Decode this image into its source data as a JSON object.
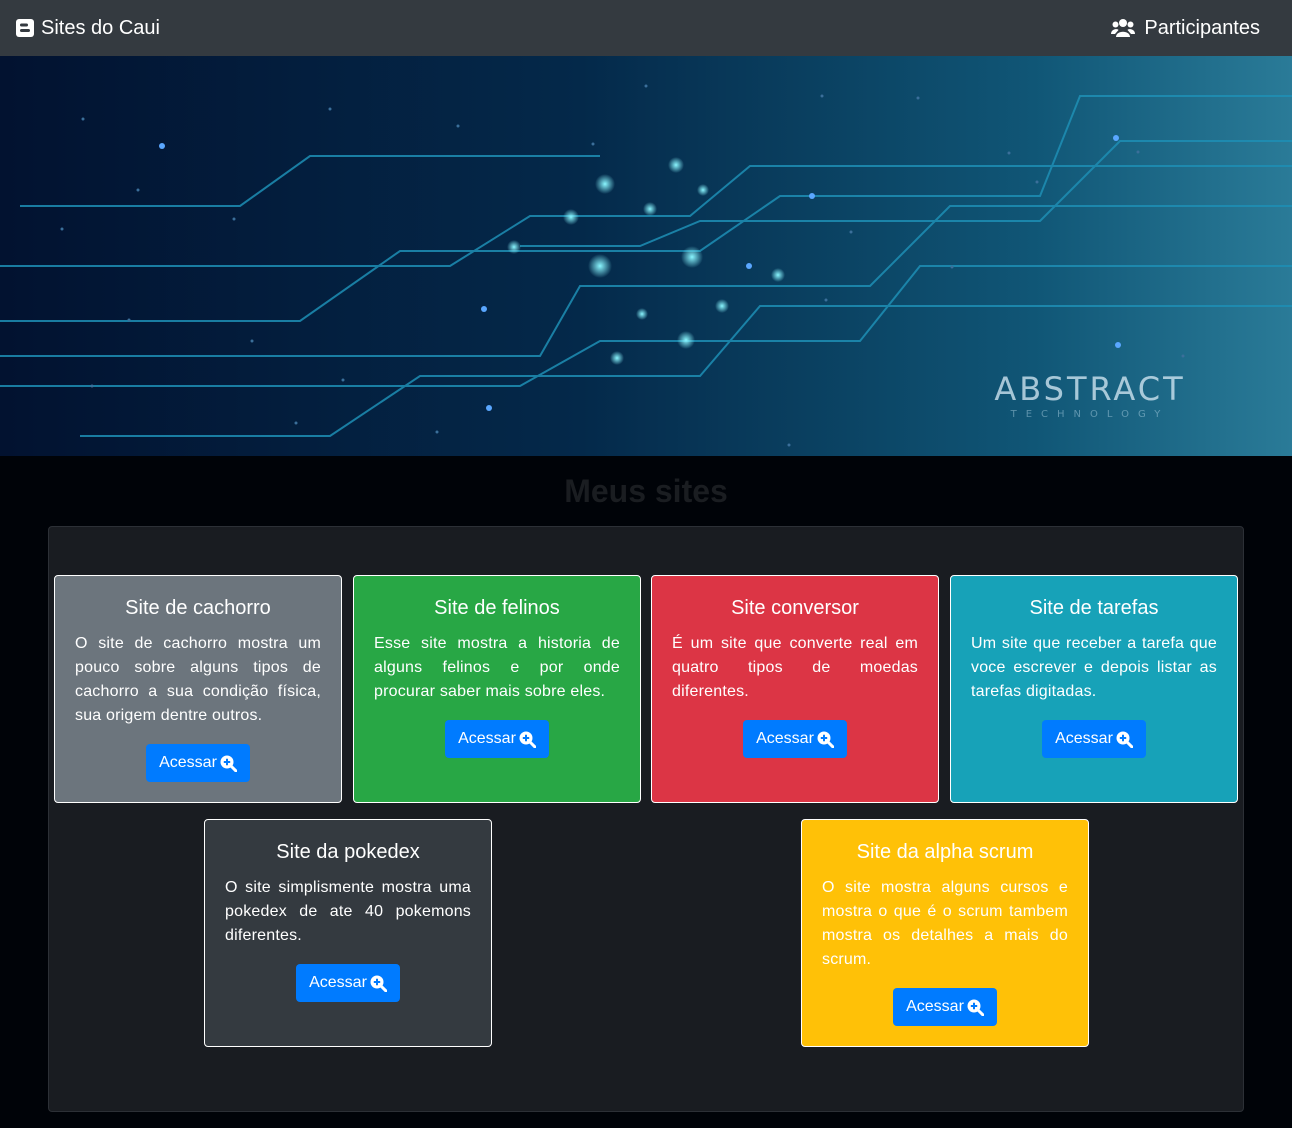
{
  "navbar": {
    "brand": "Sites do Caui",
    "participants": "Participantes"
  },
  "hero": {
    "logo_text": "ABSTRACT",
    "logo_subtext": "TECHNOLOGY"
  },
  "main": {
    "title": "Meus sites",
    "cards": [
      {
        "title": "Site de cachorro",
        "text": "O site de cachorro mostra um pouco sobre alguns tipos de cachorro a sua condição física, sua origem dentre outros.",
        "button": "Acessar",
        "color": "#6c757d"
      },
      {
        "title": "Site de felinos",
        "text": "Esse site mostra a historia de alguns felinos e por onde procurar saber mais sobre eles.",
        "button": "Acessar",
        "color": "#28a745"
      },
      {
        "title": "Site conversor",
        "text": "É um site que converte real em quatro tipos de moedas diferentes.",
        "button": "Acessar",
        "color": "#dc3545"
      },
      {
        "title": "Site de tarefas",
        "text": "Um site que receber a tarefa que voce escrever e depois listar as tarefas digitadas.",
        "button": "Acessar",
        "color": "#17a2b8"
      },
      {
        "title": "Site da pokedex",
        "text": "O site simplismente mostra uma pokedex de ate 40 pokemons diferentes.",
        "button": "Acessar",
        "color": "#343a40"
      },
      {
        "title": "Site da alpha scrum",
        "text": "O site mostra alguns cursos e mostra o que é o scrum tambem mostra os detalhes a mais do scrum.",
        "button": "Acessar",
        "color": "#ffc107"
      }
    ]
  },
  "colors": {
    "navbar": "#343a40",
    "accent": "#007bff",
    "page_bg": "#000308"
  }
}
